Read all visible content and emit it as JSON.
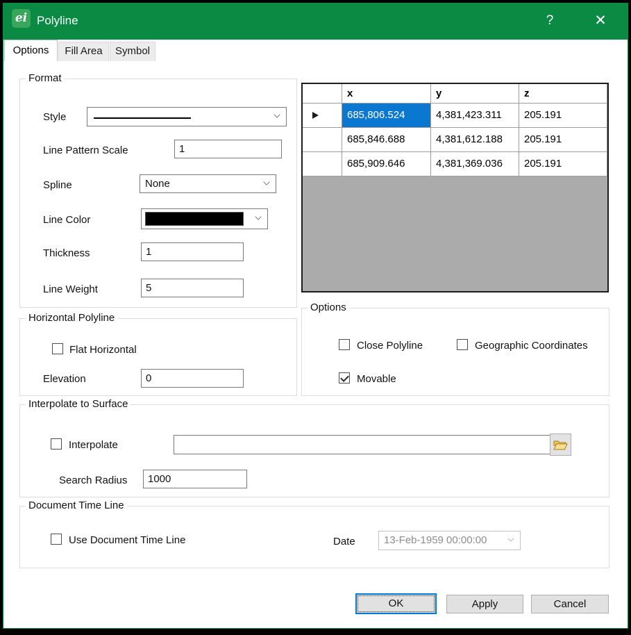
{
  "window": {
    "title": "Polyline",
    "icon_text": "ei",
    "help_label": "?",
    "close_label": "✕",
    "colors": {
      "titlebar_green": "#0a8a43",
      "selection_blue": "#0a78d0",
      "line_color": "#000000"
    }
  },
  "tabs": {
    "options": "Options",
    "fill_area": "Fill Area",
    "symbol": "Symbol"
  },
  "format": {
    "legend": "Format",
    "style_label": "Style",
    "line_pattern_scale_label": "Line Pattern Scale",
    "line_pattern_scale_value": "1",
    "spline_label": "Spline",
    "spline_value": "None",
    "line_color_label": "Line Color",
    "line_color_value": "#000000",
    "thickness_label": "Thickness",
    "thickness_value": "1",
    "line_weight_label": "Line Weight",
    "line_weight_value": "5"
  },
  "grid": {
    "columns": {
      "c0": "",
      "c1": "x",
      "c2": "y",
      "c3": "z"
    },
    "rows": [
      [
        "685,806.524",
        "4,381,423.311",
        "205.191"
      ],
      [
        "685,846.688",
        "4,381,612.188",
        "205.191"
      ],
      [
        "685,909.646",
        "4,381,369.036",
        "205.191"
      ]
    ],
    "selected_cell": {
      "row": 0,
      "col": 0
    }
  },
  "horizontal_polyline": {
    "legend": "Horizontal Polyline",
    "flat_horizontal_label": "Flat Horizontal",
    "flat_horizontal_checked": false,
    "elevation_label": "Elevation",
    "elevation_value": "0"
  },
  "options_group": {
    "legend": "Options",
    "close_polyline_label": "Close Polyline",
    "close_polyline_checked": false,
    "geographic_label": "Geographic Coordinates",
    "geographic_checked": false,
    "movable_label": "Movable",
    "movable_checked": true
  },
  "interpolate_group": {
    "legend": "Interpolate to Surface",
    "interpolate_label": "Interpolate",
    "interpolate_checked": false,
    "surface_path_value": "",
    "search_radius_label": "Search Radius",
    "search_radius_value": "1000"
  },
  "timeline_group": {
    "legend": "Document Time Line",
    "use_label": "Use Document Time Line",
    "use_checked": false,
    "date_label": "Date",
    "date_value": "13-Feb-1959 00:00:00"
  },
  "footer": {
    "ok_label": "OK",
    "apply_label": "Apply",
    "cancel_label": "Cancel"
  }
}
